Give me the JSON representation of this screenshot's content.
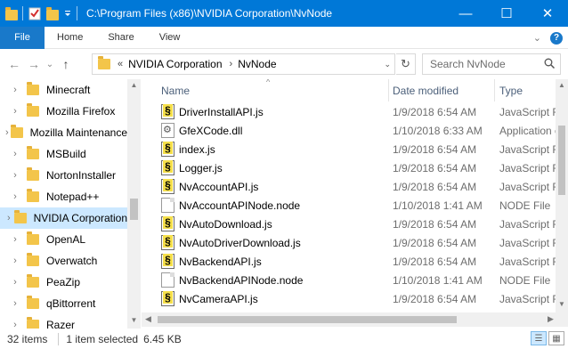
{
  "window": {
    "title": "C:\\Program Files (x86)\\NVIDIA Corporation\\NvNode",
    "controls": {
      "minimize": "—",
      "maximize": "☐",
      "close": "✕"
    }
  },
  "ribbon": {
    "tabs": [
      "File",
      "Home",
      "Share",
      "View"
    ]
  },
  "address": {
    "overflow": "«",
    "crumbs": [
      "NVIDIA Corporation",
      "NvNode"
    ],
    "search_placeholder": "Search NvNode"
  },
  "nav_pane": {
    "items": [
      {
        "label": "Minecraft",
        "selected": false
      },
      {
        "label": "Mozilla Firefox",
        "selected": false
      },
      {
        "label": "Mozilla Maintenance",
        "selected": false
      },
      {
        "label": "MSBuild",
        "selected": false
      },
      {
        "label": "NortonInstaller",
        "selected": false
      },
      {
        "label": "Notepad++",
        "selected": false
      },
      {
        "label": "NVIDIA Corporation",
        "selected": true
      },
      {
        "label": "OpenAL",
        "selected": false
      },
      {
        "label": "Overwatch",
        "selected": false
      },
      {
        "label": "PeaZip",
        "selected": false
      },
      {
        "label": "qBittorrent",
        "selected": false
      },
      {
        "label": "Razer",
        "selected": false
      }
    ]
  },
  "file_list": {
    "columns": {
      "name": "Name",
      "date": "Date modified",
      "type": "Type"
    },
    "rows": [
      {
        "name": "DriverInstallAPI.js",
        "date": "1/9/2018 6:54 AM",
        "type": "JavaScript File",
        "icon": "js-file-icon"
      },
      {
        "name": "GfeXCode.dll",
        "date": "1/10/2018 6:33 AM",
        "type": "Application extension",
        "icon": "dll-file-icon"
      },
      {
        "name": "index.js",
        "date": "1/9/2018 6:54 AM",
        "type": "JavaScript File",
        "icon": "js-file-icon"
      },
      {
        "name": "Logger.js",
        "date": "1/9/2018 6:54 AM",
        "type": "JavaScript File",
        "icon": "js-file-icon"
      },
      {
        "name": "NvAccountAPI.js",
        "date": "1/9/2018 6:54 AM",
        "type": "JavaScript File",
        "icon": "js-file-icon"
      },
      {
        "name": "NvAccountAPINode.node",
        "date": "1/10/2018 1:41 AM",
        "type": "NODE File",
        "icon": "node-file-icon"
      },
      {
        "name": "NvAutoDownload.js",
        "date": "1/9/2018 6:54 AM",
        "type": "JavaScript File",
        "icon": "js-file-icon"
      },
      {
        "name": "NvAutoDriverDownload.js",
        "date": "1/9/2018 6:54 AM",
        "type": "JavaScript File",
        "icon": "js-file-icon"
      },
      {
        "name": "NvBackendAPI.js",
        "date": "1/9/2018 6:54 AM",
        "type": "JavaScript File",
        "icon": "js-file-icon"
      },
      {
        "name": "NvBackendAPINode.node",
        "date": "1/10/2018 1:41 AM",
        "type": "NODE File",
        "icon": "node-file-icon"
      },
      {
        "name": "NvCameraAPI.js",
        "date": "1/9/2018 6:54 AM",
        "type": "JavaScript File",
        "icon": "js-file-icon"
      }
    ]
  },
  "status": {
    "item_count": "32 items",
    "selection": "1 item selected",
    "size": "6.45 KB"
  }
}
